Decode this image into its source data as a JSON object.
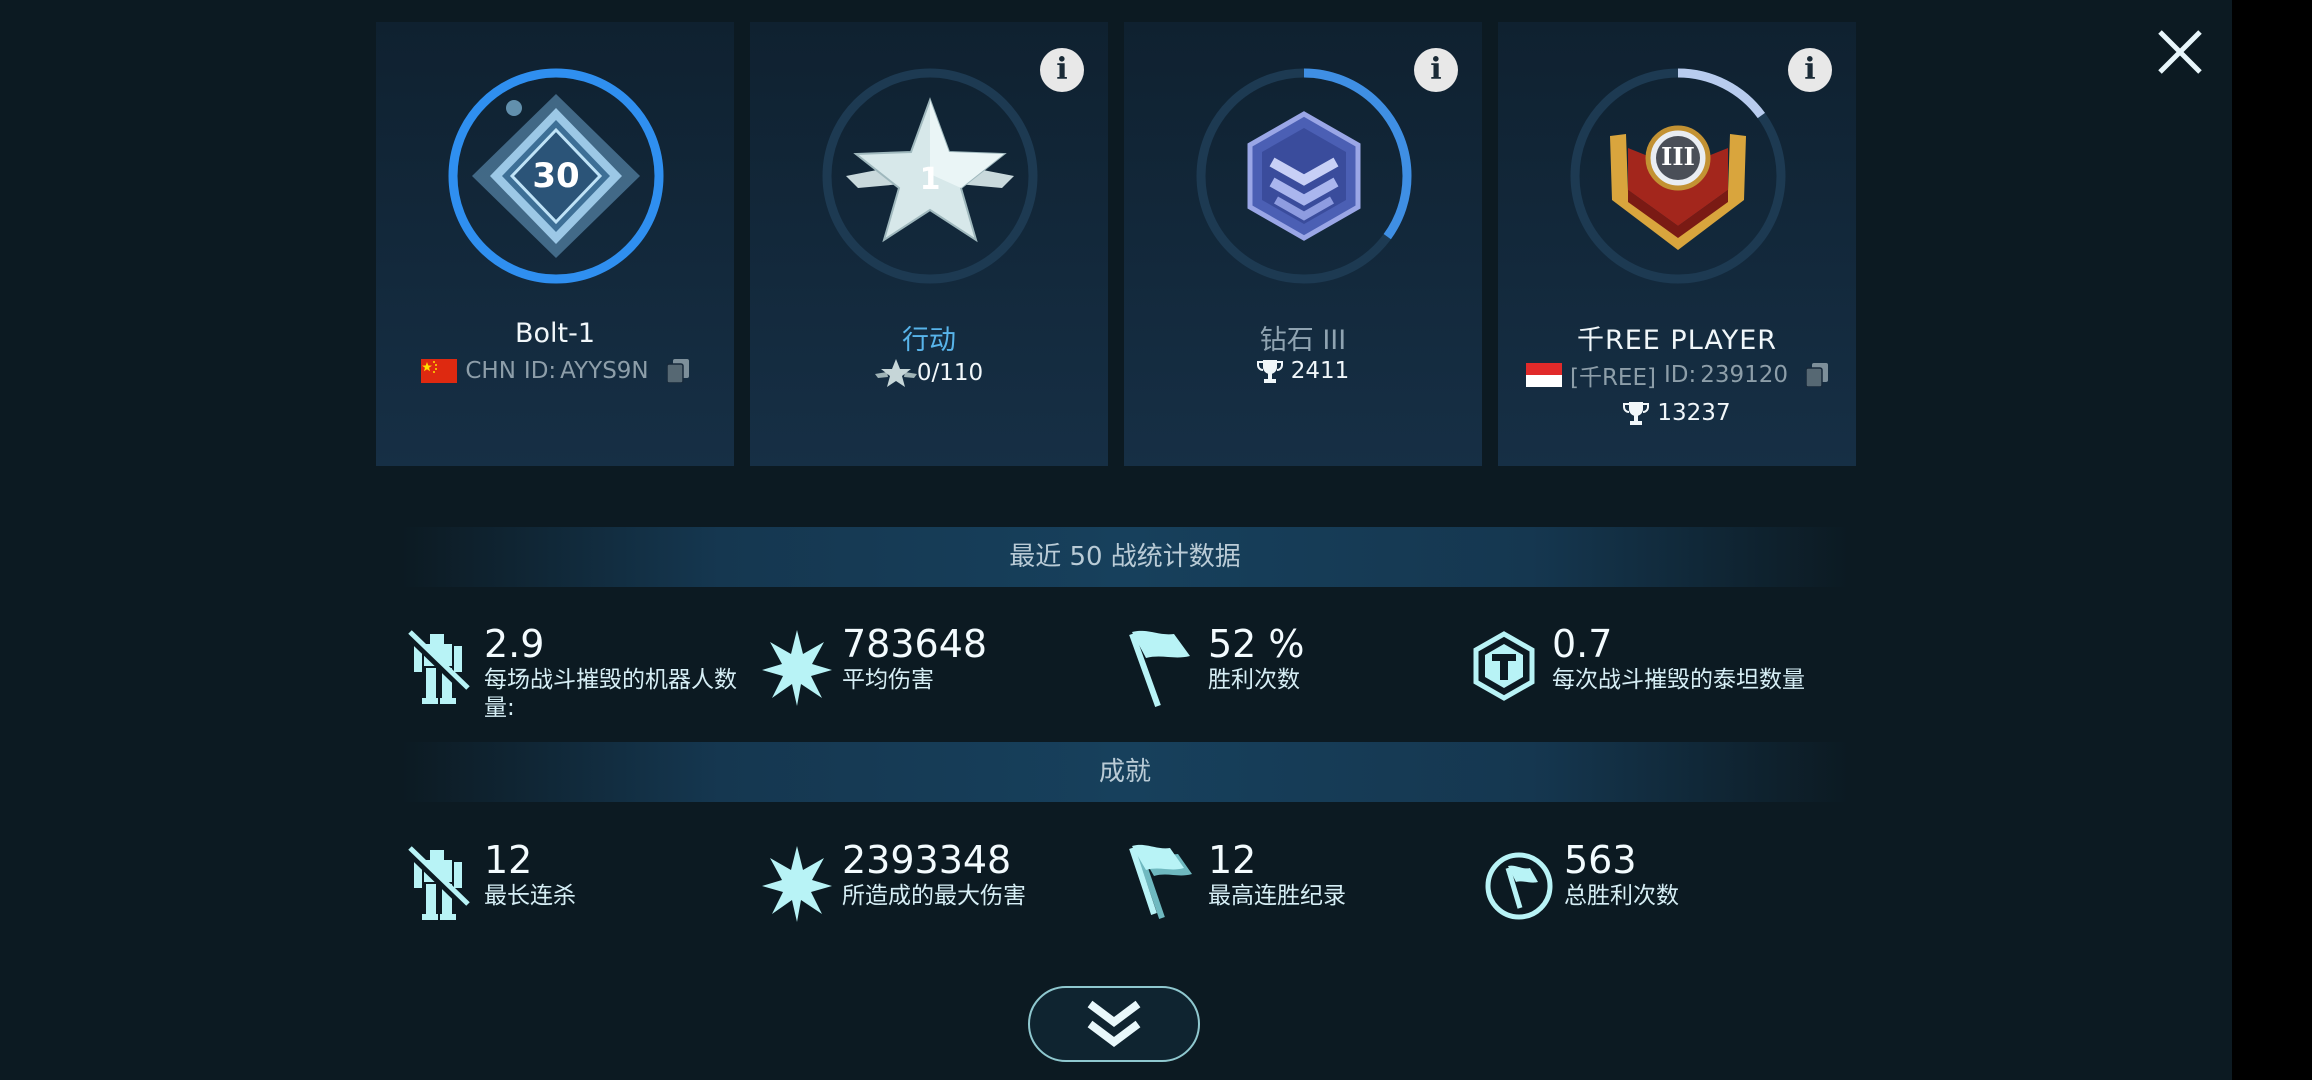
{
  "cards": [
    {
      "badge_icon": "player-level-badge-icon",
      "level": "30",
      "name": "Bolt-1",
      "flag_icon": "china-flag-icon",
      "country": "CHN",
      "id_label": "ID:",
      "id_value": "AYYS9N",
      "ring_progress": 1.0
    },
    {
      "badge_icon": "operation-star-icon",
      "rank": "1",
      "name": "行动",
      "progress_text": "0/110",
      "ring_progress": 0.0
    },
    {
      "badge_icon": "diamond-league-icon",
      "name": "钻石 III",
      "trophies": "2411",
      "ring_progress": 0.35
    },
    {
      "badge_icon": "clan-gold-badge-icon",
      "badge_numeral": "III",
      "name": "千REE PLAYER",
      "flag_icon": "indonesia-flag-icon",
      "tag": "[千REE]",
      "id_label": "ID:",
      "id_value": "239120",
      "trophies": "13237",
      "ring_progress": 0.15
    }
  ],
  "recent_title": "最近 50 战统计数据",
  "recent_stats": [
    {
      "value": "2.9",
      "label": "每场战斗摧毁的机器人数量:",
      "icon": "destroyed-robot-icon"
    },
    {
      "value": "783648",
      "label": "平均伤害",
      "icon": "damage-burst-icon"
    },
    {
      "value": "52 %",
      "label": "胜利次数",
      "icon": "victory-flag-icon"
    },
    {
      "value": "0.7",
      "label": "每次战斗摧毁的泰坦数量",
      "icon": "titan-hexagon-icon"
    }
  ],
  "achievements_title": "成就",
  "achievements": [
    {
      "value": "12",
      "label": "最长连杀",
      "icon": "destroyed-robot-icon"
    },
    {
      "value": "2393348",
      "label": "所造成的最大伤害",
      "icon": "damage-burst-icon"
    },
    {
      "value": "12",
      "label": "最高连胜纪录",
      "icon": "win-streak-flags-icon"
    },
    {
      "value": "563",
      "label": "总胜利次数",
      "icon": "total-wins-flag-icon"
    }
  ],
  "colors": {
    "background": "#0c1a22",
    "accent_cyan": "#b8f3f6",
    "ring_blue": "#2f8ff0",
    "label_blue": "#58b4ea",
    "gold": "#e2b14a"
  }
}
